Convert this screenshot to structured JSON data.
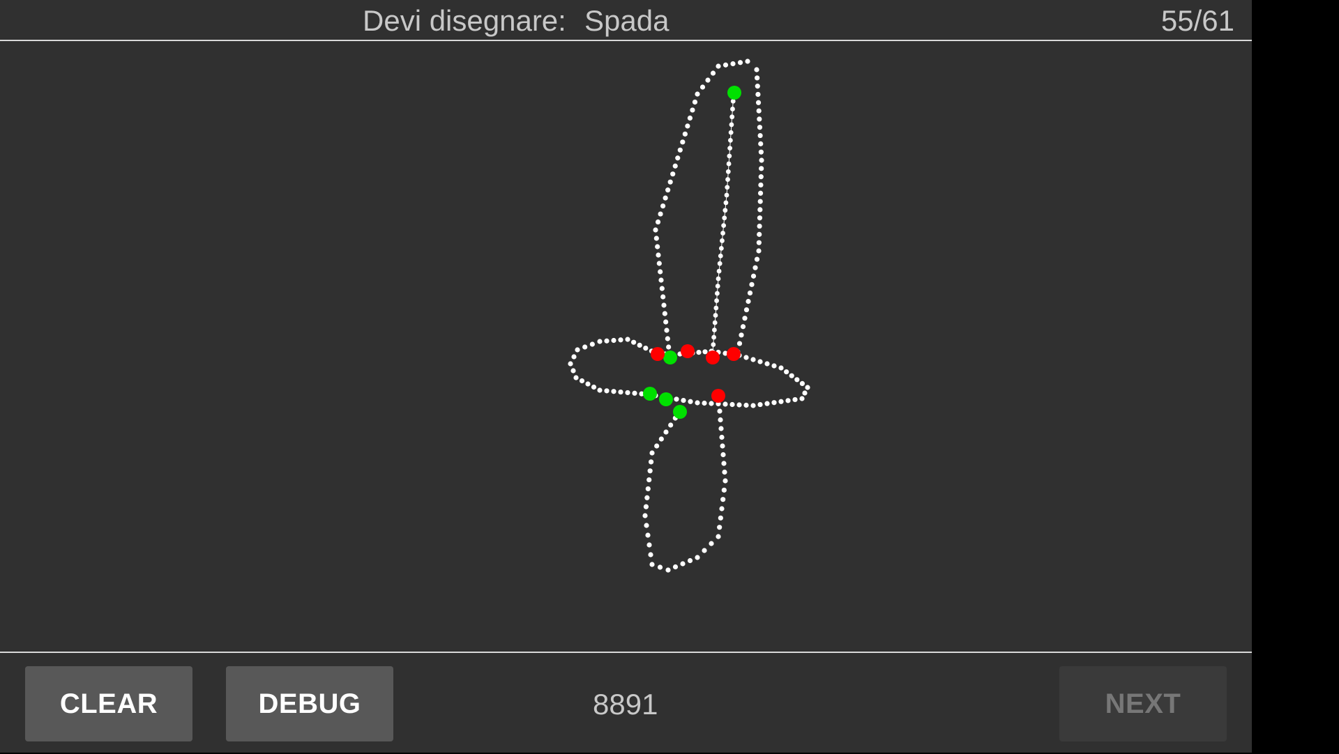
{
  "header": {
    "prompt_label": "Devi disegnare:",
    "prompt_word": "Spada",
    "progress": "55/61"
  },
  "footer": {
    "clear_label": "CLEAR",
    "debug_label": "DEBUG",
    "score": "8891",
    "next_label": "NEXT"
  },
  "colors": {
    "background": "#303030",
    "stroke_dot": "#ffffff",
    "endpoint_start": "#00e000",
    "endpoint_end": "#ff0000",
    "next_disabled_text": "#777777"
  }
}
